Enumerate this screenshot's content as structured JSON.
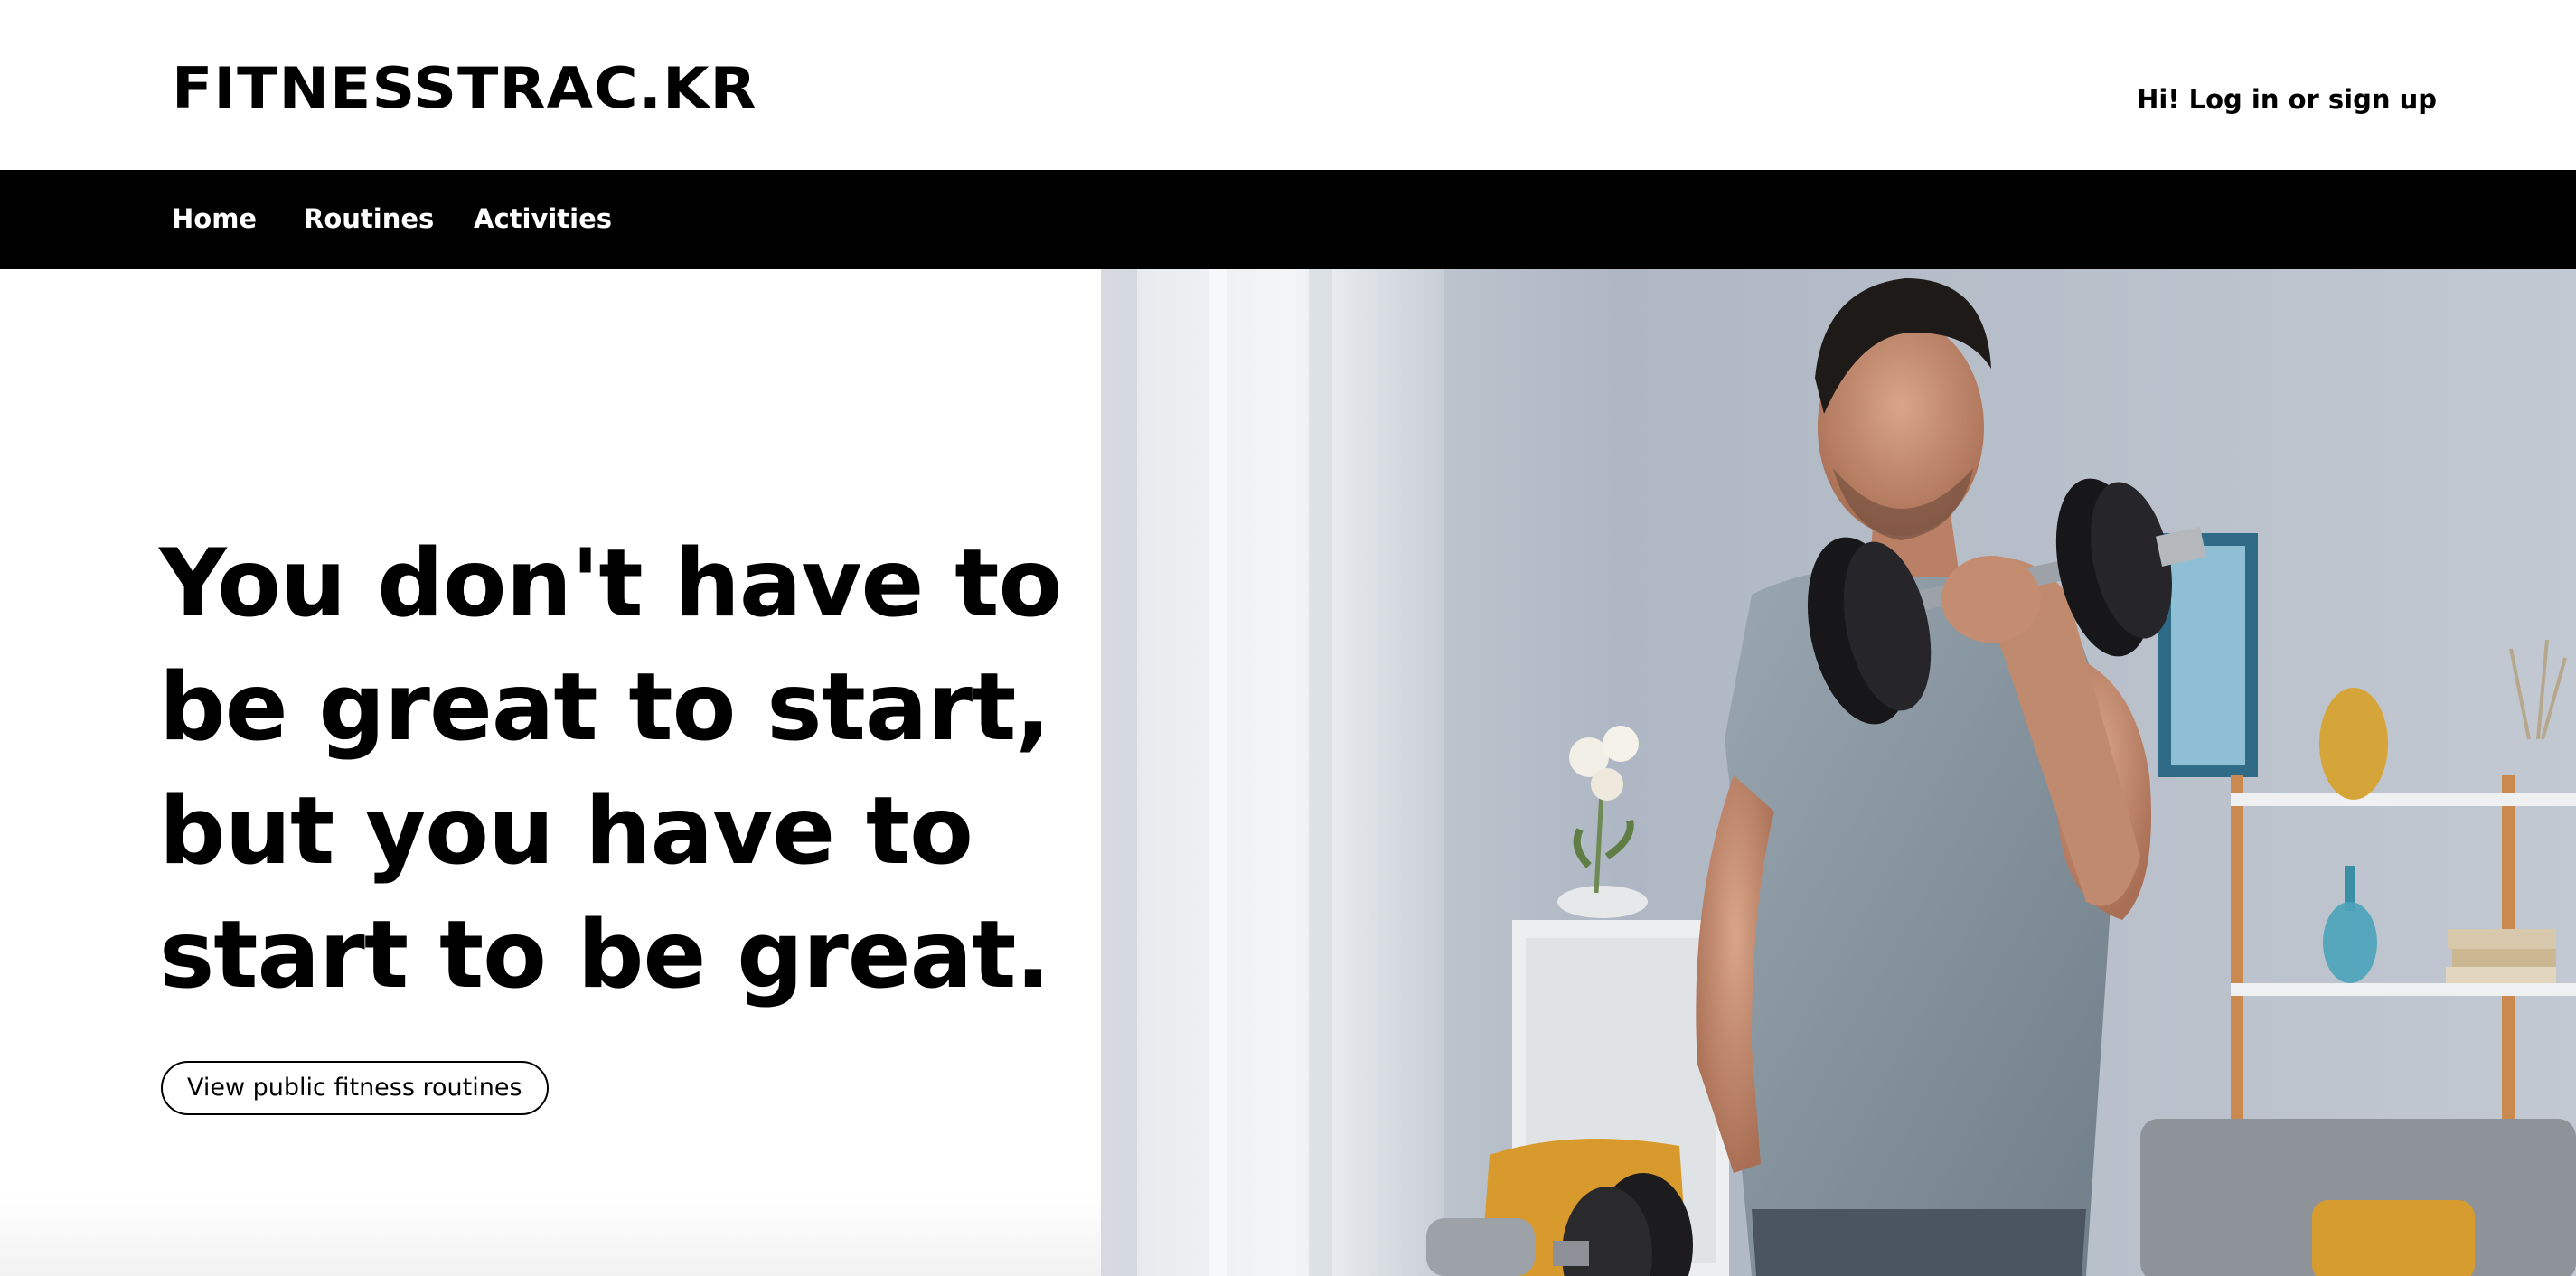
{
  "header": {
    "logo_text": "FITNESSTRAC.KR",
    "auth_link": "Hi! Log in or sign up"
  },
  "nav": {
    "items": [
      {
        "label": "Home"
      },
      {
        "label": "Routines"
      },
      {
        "label": "Activities"
      }
    ]
  },
  "hero": {
    "headline_lines": [
      "You don't have to",
      "be great to start,",
      "but you have to",
      "start to be great."
    ],
    "cta_label": "View public fitness routines",
    "image_subject": "man-lifting-dumbbell-photo"
  },
  "colors": {
    "navbar_bg": "#000000",
    "nav_text": "#ffffff",
    "page_bg": "#ffffff",
    "text": "#000000"
  }
}
